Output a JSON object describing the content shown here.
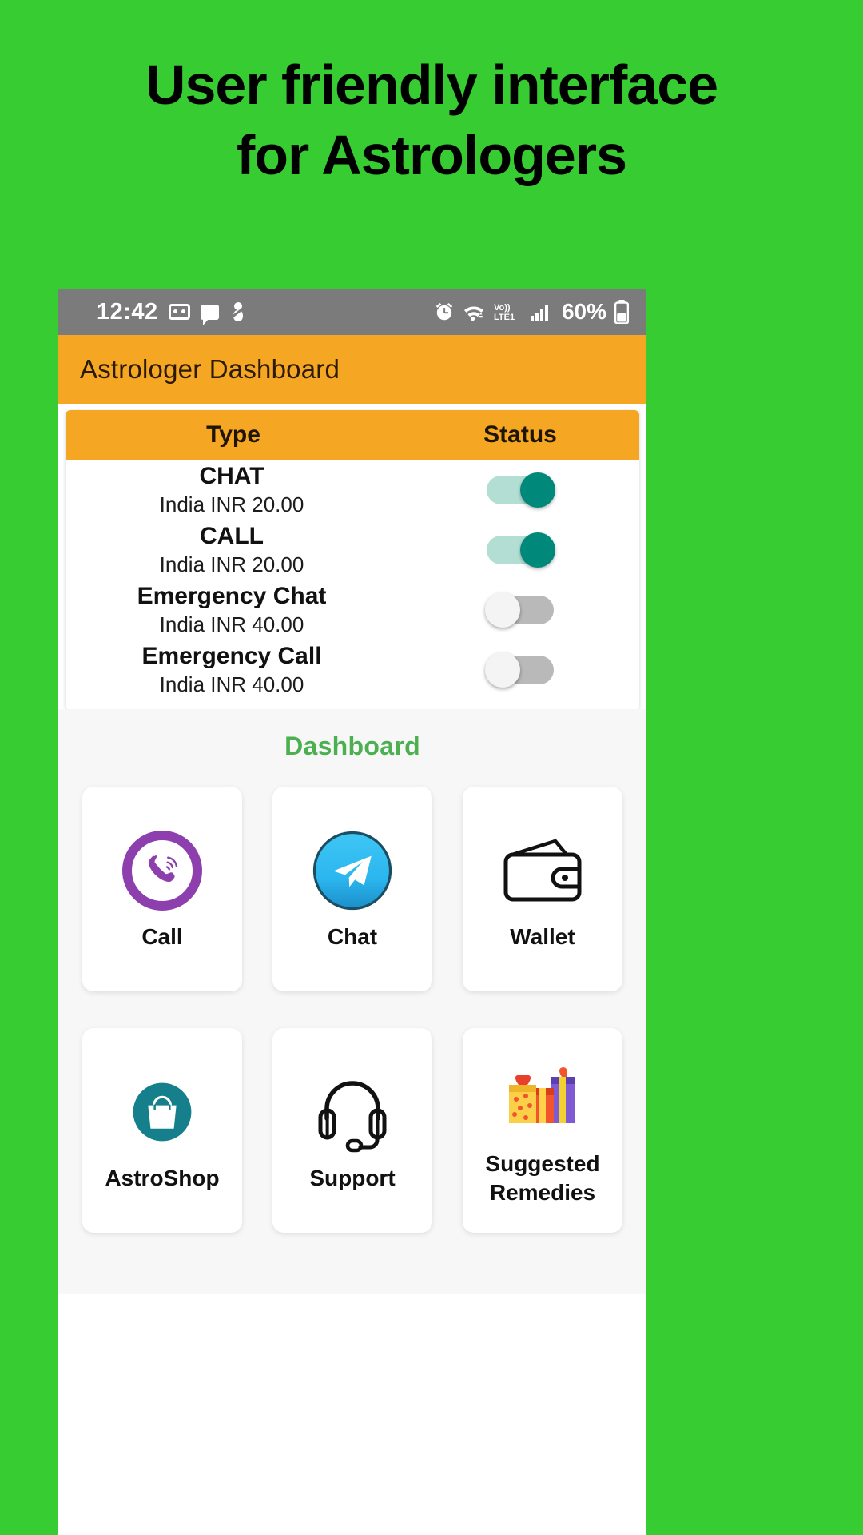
{
  "promo": {
    "line1": "User friendly interface",
    "line2": "for Astrologers"
  },
  "colors": {
    "background_green": "#36cc32",
    "appbar_orange": "#f5a623",
    "statusbar_grey": "#7b7b7b",
    "dashboard_label_green": "#4caf50",
    "toggle_on": "#00897b",
    "toggle_off": "#b9b9b9",
    "viber_purple": "#8e3fae",
    "telegram_blue": "#29b6f6",
    "astroshop_teal": "#15808c"
  },
  "statusbar": {
    "time": "12:42",
    "left_icons": [
      "voicemail-icon",
      "message-bubble-icon",
      "do-not-disturb-icon"
    ],
    "right_icons": [
      "alarm-icon",
      "wifi-icon",
      "volte-icon",
      "signal-bars-icon"
    ],
    "volte_label": "Vo))\nLTE1",
    "battery_percent": "60%"
  },
  "appbar": {
    "title": "Astrologer Dashboard"
  },
  "table": {
    "headers": {
      "type": "Type",
      "status": "Status"
    },
    "rows": [
      {
        "title": "CHAT",
        "price": "India INR 20.00",
        "enabled": true
      },
      {
        "title": "CALL",
        "price": "India INR 20.00",
        "enabled": true
      },
      {
        "title": "Emergency Chat",
        "price": "India INR 40.00",
        "enabled": false
      },
      {
        "title": "Emergency Call",
        "price": "India INR 40.00",
        "enabled": false
      }
    ]
  },
  "dashboard": {
    "section_label": "Dashboard",
    "cards": [
      {
        "label": "Call",
        "icon": "phone-call-icon"
      },
      {
        "label": "Chat",
        "icon": "paper-plane-chat-icon"
      },
      {
        "label": "Wallet",
        "icon": "wallet-icon"
      },
      {
        "label": "AstroShop",
        "icon": "shopping-bag-icon"
      },
      {
        "label": "Support",
        "icon": "headset-support-icon"
      },
      {
        "label": "Suggested\nRemedies",
        "icon": "gift-boxes-icon"
      }
    ],
    "card_labels": {
      "call": "Call",
      "chat": "Chat",
      "wallet": "Wallet",
      "astroshop": "AstroShop",
      "support": "Support",
      "remedies_line1": "Suggested",
      "remedies_line2": "Remedies"
    }
  }
}
